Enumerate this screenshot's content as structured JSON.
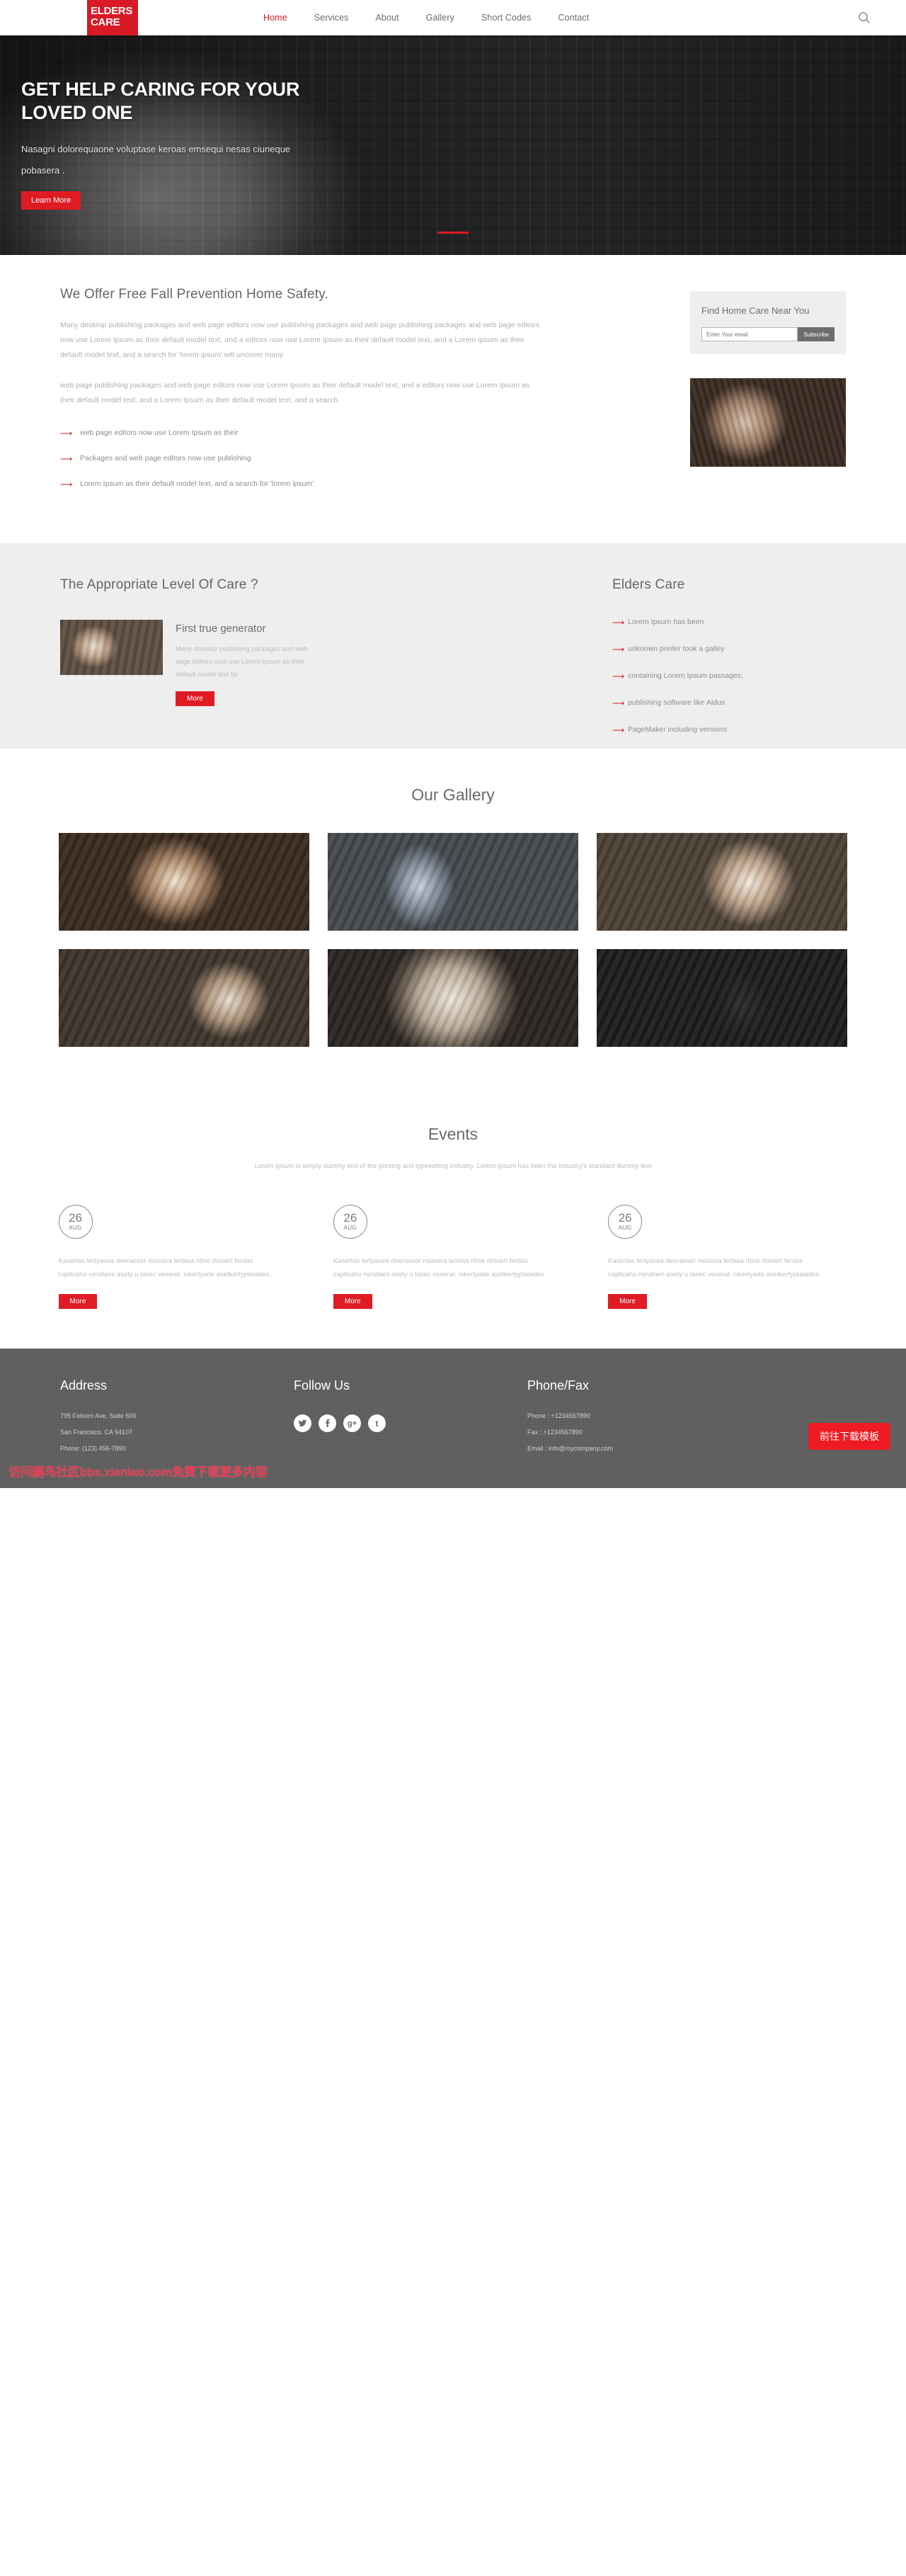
{
  "header": {
    "logo_line1": "ELDERS",
    "logo_line2": "CARE",
    "nav": [
      {
        "label": "Home",
        "active": true
      },
      {
        "label": "Services",
        "active": false
      },
      {
        "label": "About",
        "active": false
      },
      {
        "label": "Gallery",
        "active": false
      },
      {
        "label": "Short Codes",
        "active": false
      },
      {
        "label": "Contact",
        "active": false
      }
    ],
    "search_icon": "search-icon"
  },
  "hero": {
    "title": "GET HELP CARING FOR YOUR LOVED ONE",
    "subtitle": "Nasagni dolorequaone voluptase keroas emsequi nesas ciuneque pobasera .",
    "button": "Learn More"
  },
  "offer": {
    "heading": "We Offer Free Fall Prevention Home Safety.",
    "paragraph1": "Many desktop publishing packages and web page editors now use publishing packages and web page publishing packages and web page editors now use Lorem Ipsum as their default model text, and a editors now use Lorem Ipsum as their default model text, and a Lorem Ipsum as their default model text, and a search for 'lorem ipsum' will uncover many",
    "paragraph2": "web page publishing packages and web page editors now use Lorem Ipsum as their default model text, and a editors now use Lorem Ipsum as their default model text, and a Lorem Ipsum as their default model text, and a search.",
    "bullets": [
      "web page editors now use Lorem Ipsum as their",
      "Packages and web page editors now use publishing",
      "Lorem Ipsum as their default model text, and a search for 'lorem ipsum'"
    ],
    "sidebar": {
      "title": "Find Home Care Near You",
      "email_placeholder": "Enter Your email",
      "email_value": "",
      "subscribe_label": "Subscribe"
    }
  },
  "care": {
    "heading": "The Appropriate Level Of Care ?",
    "card": {
      "title": "First true generator",
      "text": "Many desktop publishing packages and web page editors now use Lorem Ipsum as their default model text for",
      "button": "More"
    },
    "right_heading": "Elders Care",
    "right_bullets": [
      "Lorem Ipsum has been",
      "unknown printer took a galley",
      "containing Lorem Ipsum passages,",
      "publishing software like Aldus",
      "PageMaker including versions"
    ]
  },
  "gallery": {
    "heading": "Our Gallery",
    "items": [
      {
        "name": "gallery-photo-1"
      },
      {
        "name": "gallery-photo-2"
      },
      {
        "name": "gallery-photo-3"
      },
      {
        "name": "gallery-photo-4"
      },
      {
        "name": "gallery-photo-5"
      },
      {
        "name": "gallery-photo-6"
      }
    ]
  },
  "events": {
    "heading": "Events",
    "subtitle": "Lorem Ipsum is simply dummy text of the printing and typesetting industry. Lorem Ipsum has been the industry's standard dummy text",
    "items": [
      {
        "day": "26",
        "month": "AUG",
        "text": "Kasertas lertyasea deeraeser miasera lertasa ritise doloert ferdas caplicaho nerafaes asety u lasec veserat. nikertyade asetkertyptaiades.",
        "button": "More"
      },
      {
        "day": "26",
        "month": "AUG",
        "text": "Kasertas lertyasea deeraeser miasera lertasa ritise doloert ferdas caplicaho nerafaes asety u lasec veserat. nikertyade asetkertyptaiades.",
        "button": "More"
      },
      {
        "day": "26",
        "month": "AUG",
        "text": "Kasertas lertyasea deeraeser miasera lertasa ritise doloert ferdas caplicaho nerafaes asety u lasec veserat. nikertyade asetkertyptaiades.",
        "button": "More"
      }
    ]
  },
  "footer": {
    "address_heading": "Address",
    "address_line1": "795 Folsom Ave, Suite 600",
    "address_line2": "San Francisco, CA 94107",
    "address_line3": "Phone: (123) 456-7890",
    "follow_heading": "Follow Us",
    "socials": [
      {
        "name": "twitter-icon",
        "glyph": "t"
      },
      {
        "name": "facebook-icon",
        "glyph": "f"
      },
      {
        "name": "google-plus-icon",
        "glyph": "g+"
      },
      {
        "name": "tumblr-icon",
        "glyph": "t"
      }
    ],
    "phone_heading": "Phone/Fax",
    "phone_line": "Phone : +1234567890",
    "fax_line": "Fax : +1234567890",
    "email_line": "Email : info@mycompany.com",
    "watermark": "访问鹂鸟社区bbs.xieniao.com免费下载更多内容",
    "download_button": "前往下载模板"
  },
  "colors": {
    "brand_red": "#d71a26",
    "button_red": "#e01b24",
    "gray_section": "#eeeeee",
    "footer_gray": "#5e5e5e"
  }
}
